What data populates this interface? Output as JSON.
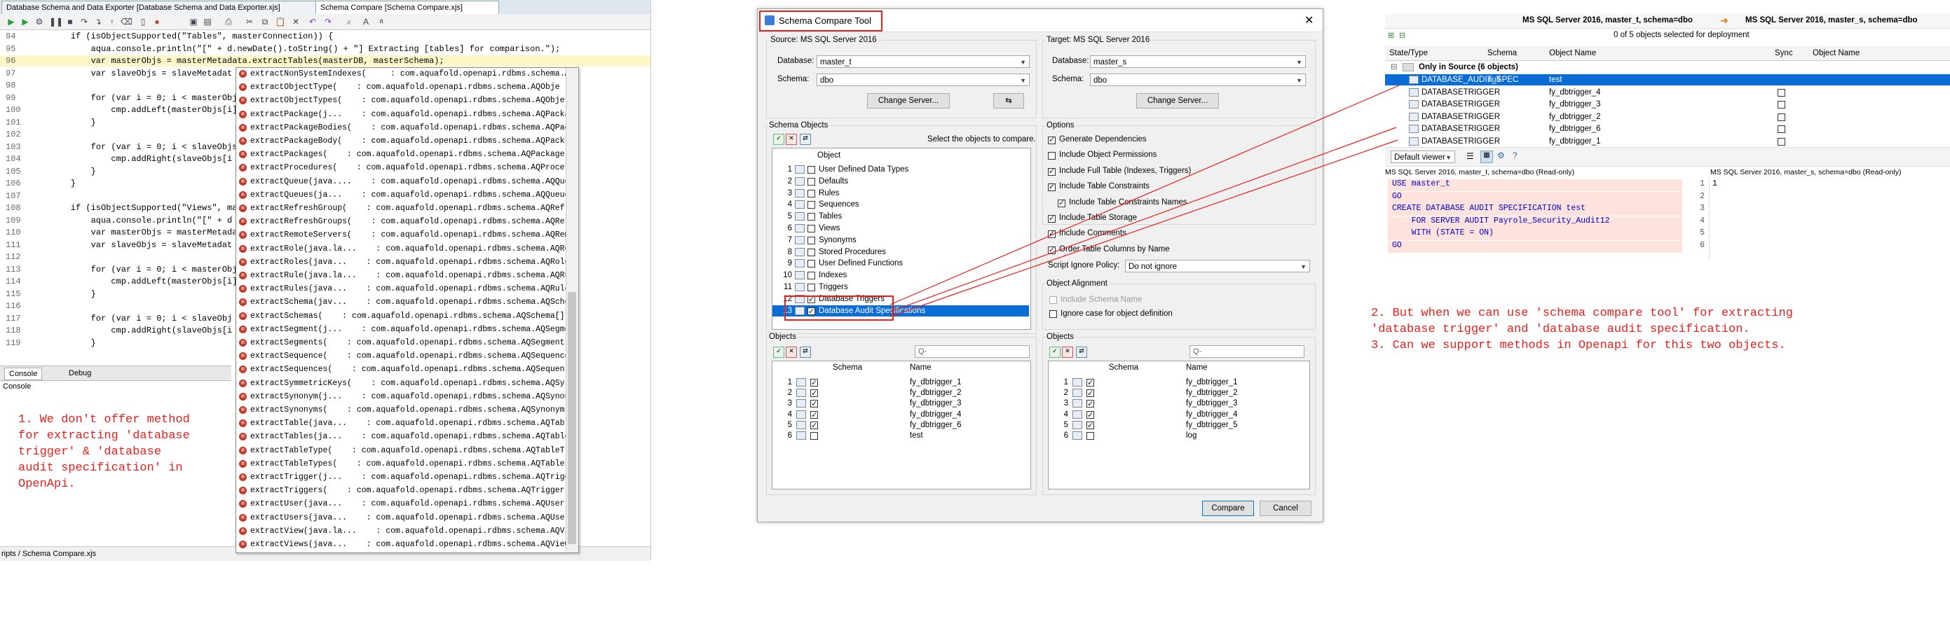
{
  "ide": {
    "tabs": [
      "Database Schema and Data Exporter [Database Schema and Data Exporter.xjs]",
      "Schema Compare [Schema Compare.xjs]"
    ],
    "code_lines": [
      {
        "n": "94",
        "t": "    if (isObjectSupported(\"Tables\", masterConnection)) {"
      },
      {
        "n": "95",
        "t": "        aqua.console.println(\"[\" + d.newDate().toString() + \"] Extracting [tables] for comparison.\");"
      },
      {
        "n": "96",
        "t": "        var masterObjs = masterMetadata.extractTables(masterDB, masterSchema);"
      },
      {
        "n": "97",
        "t": "        var slaveObjs = slaveMetadat"
      },
      {
        "n": "98",
        "t": ""
      },
      {
        "n": "99",
        "t": "        for (var i = 0; i < masterObj"
      },
      {
        "n": "100",
        "t": "            cmp.addLeft(masterObjs[i]"
      },
      {
        "n": "101",
        "t": "        }"
      },
      {
        "n": "102",
        "t": ""
      },
      {
        "n": "103",
        "t": "        for (var i = 0; i < slaveObjs"
      },
      {
        "n": "104",
        "t": "            cmp.addRight(slaveObjs[i"
      },
      {
        "n": "105",
        "t": "        }"
      },
      {
        "n": "106",
        "t": "    }"
      },
      {
        "n": "107",
        "t": ""
      },
      {
        "n": "108",
        "t": "    if (isObjectSupported(\"Views\", ma"
      },
      {
        "n": "109",
        "t": "        aqua.console.println(\"[\" + d"
      },
      {
        "n": "110",
        "t": "        var masterObjs = masterMetada"
      },
      {
        "n": "111",
        "t": "        var slaveObjs = slaveMetadat"
      },
      {
        "n": "112",
        "t": ""
      },
      {
        "n": "113",
        "t": "        for (var i = 0; i < masterObj"
      },
      {
        "n": "114",
        "t": "            cmp.addLeft(masterObjs[i]"
      },
      {
        "n": "115",
        "t": "        }"
      },
      {
        "n": "116",
        "t": ""
      },
      {
        "n": "117",
        "t": "        for (var i = 0; i < slaveObj"
      },
      {
        "n": "118",
        "t": "            cmp.addRight(slaveObjs[i"
      },
      {
        "n": "119",
        "t": "        }"
      }
    ],
    "autocomplete": [
      "extractNonSystemIndexes(     : com.aquafold.openapi.rdbms.schema.A",
      "extractObjectType(    : com.aquafold.openapi.rdbms.schema.AQObje",
      "extractObjectTypes(    : com.aquafold.openapi.rdbms.schema.AQObje",
      "extractPackage(j...    : com.aquafold.openapi.rdbms.schema.AQPackage",
      "extractPackageBodies(    : com.aquafold.openapi.rdbms.schema.AQPack",
      "extractPackageBody(    : com.aquafold.openapi.rdbms.schema.AQPack",
      "extractPackages(    : com.aquafold.openapi.rdbms.schema.AQPackage[]",
      "extractProcedures(    : com.aquafold.openapi.rdbms.schema.AQProce",
      "extractQueue(java....    : com.aquafold.openapi.rdbms.schema.AQQueue",
      "extractQueues(ja...    : com.aquafold.openapi.rdbms.schema.AQQueue[",
      "extractRefreshGroup(    : com.aquafold.openapi.rdbms.schema.AQRef",
      "extractRefreshGroups(    : com.aquafold.openapi.rdbms.schema.AQRe",
      "extractRemoteServers(    : com.aquafold.openapi.rdbms.schema.AQRem",
      "extractRole(java.la...    : com.aquafold.openapi.rdbms.schema.AQRole",
      "extractRoles(java...    : com.aquafold.openapi.rdbms.schema.AQRole[]",
      "extractRule(java.la...    : com.aquafold.openapi.rdbms.schema.AQRule",
      "extractRules(java...    : com.aquafold.openapi.rdbms.schema.AQRule[]",
      "extractSchema(jav...    : com.aquafold.openapi.rdbms.schema.AQSchema",
      "extractSchemas(    : com.aquafold.openapi.rdbms.schema.AQSchema[]",
      "extractSegment(j...    : com.aquafold.openapi.rdbms.schema.AQSegment",
      "extractSegments(    : com.aquafold.openapi.rdbms.schema.AQSegment[]",
      "extractSequence(    : com.aquafold.openapi.rdbms.schema.AQSequence",
      "extractSequences(    : com.aquafold.openapi.rdbms.schema.AQSequen",
      "extractSymmetricKeys(    : com.aquafold.openapi.rdbms.schema.AQSy",
      "extractSynonym(j...    : com.aquafold.openapi.rdbms.schema.AQSynonym",
      "extractSynonyms(    : com.aquafold.openapi.rdbms.schema.AQSynonym[]",
      "extractTable(java...    : com.aquafold.openapi.rdbms.schema.AQTable",
      "extractTables(ja...    : com.aquafold.openapi.rdbms.schema.AQTable[]",
      "extractTableType(    : com.aquafold.openapi.rdbms.schema.AQTableT",
      "extractTableTypes(    : com.aquafold.openapi.rdbms.schema.AQTable",
      "extractTrigger(j...    : com.aquafold.openapi.rdbms.schema.AQTrigger",
      "extractTriggers(    : com.aquafold.openapi.rdbms.schema.AQTrigger[]",
      "extractUser(java...    : com.aquafold.openapi.rdbms.schema.AQUser",
      "extractUsers(java...    : com.aquafold.openapi.rdbms.schema.AQUser[]",
      "extractView(java.la...    : com.aquafold.openapi.rdbms.schema.AQView",
      "extractViews(java...    : com.aquafold.openapi.rdbms.schema.AQView[]"
    ],
    "console_tab": "Console",
    "debug_tab": "Debug",
    "console_label": "Console",
    "status": "ripts / Schema Compare.xjs",
    "note1": "1. We don't offer method\nfor extracting 'database\ntrigger' & 'database\naudit specification' in\nOpenApi."
  },
  "dialog": {
    "title": "Schema Compare Tool",
    "source": {
      "label": "Source: MS SQL Server 2016",
      "db_label": "Database:",
      "db_value": "master_t",
      "schema_label": "Schema:",
      "schema_value": "dbo",
      "change_server": "Change Server..."
    },
    "target": {
      "label": "Target: MS SQL Server 2016",
      "db_label": "Database:",
      "db_value": "master_s",
      "schema_label": "Schema:",
      "schema_value": "dbo",
      "change_server": "Change Server..."
    },
    "schema_objects_label": "Schema Objects",
    "select_hint": "Select the objects to compare.",
    "object_col": "Object",
    "objects": [
      {
        "n": "1",
        "name": "User Defined Data Types",
        "checked": false
      },
      {
        "n": "2",
        "name": "Defaults",
        "checked": false
      },
      {
        "n": "3",
        "name": "Rules",
        "checked": false
      },
      {
        "n": "4",
        "name": "Sequences",
        "checked": false
      },
      {
        "n": "5",
        "name": "Tables",
        "checked": false
      },
      {
        "n": "6",
        "name": "Views",
        "checked": false
      },
      {
        "n": "7",
        "name": "Synonyms",
        "checked": false
      },
      {
        "n": "8",
        "name": "Stored Procedures",
        "checked": false
      },
      {
        "n": "9",
        "name": "User Defined Functions",
        "checked": false
      },
      {
        "n": "10",
        "name": "Indexes",
        "checked": false
      },
      {
        "n": "11",
        "name": "Triggers",
        "checked": false
      },
      {
        "n": "12",
        "name": "Database Triggers",
        "checked": true
      },
      {
        "n": "13",
        "name": "Database Audit Specifications",
        "checked": true
      }
    ],
    "options_label": "Options",
    "options": [
      {
        "label": "Generate Dependencies",
        "checked": true,
        "indent": false
      },
      {
        "label": "Include Object Permissions",
        "checked": false,
        "indent": false
      },
      {
        "label": "Include Full Table (Indexes, Triggers)",
        "checked": true,
        "indent": false
      },
      {
        "label": "Include Table Constraints",
        "checked": true,
        "indent": false
      },
      {
        "label": "Include Table Constraints Names",
        "checked": true,
        "indent": true
      },
      {
        "label": "Include Table Storage",
        "checked": true,
        "indent": false
      },
      {
        "label": "Include Comments",
        "checked": true,
        "indent": false
      },
      {
        "label": "Order Table Columns by Name",
        "checked": true,
        "indent": false
      }
    ],
    "script_ignore_label": "Script Ignore Policy:",
    "script_ignore_value": "Do not ignore",
    "alignment_label": "Object Alignment",
    "include_schema_name": "Include Schema Name",
    "ignore_case": "Ignore case for object definition",
    "objects_label": "Objects",
    "col_schema": "Schema",
    "col_name": "Name",
    "left_objects": [
      {
        "n": "1",
        "name": "fy_dbtrigger_1",
        "checked": true
      },
      {
        "n": "2",
        "name": "fy_dbtrigger_2",
        "checked": true
      },
      {
        "n": "3",
        "name": "fy_dbtrigger_3",
        "checked": true
      },
      {
        "n": "4",
        "name": "fy_dbtrigger_4",
        "checked": true
      },
      {
        "n": "5",
        "name": "fy_dbtrigger_6",
        "checked": true
      },
      {
        "n": "6",
        "name": "test",
        "checked": false
      }
    ],
    "right_objects": [
      {
        "n": "1",
        "name": "fy_dbtrigger_1",
        "checked": true
      },
      {
        "n": "2",
        "name": "fy_dbtrigger_2",
        "checked": true
      },
      {
        "n": "3",
        "name": "fy_dbtrigger_3",
        "checked": true
      },
      {
        "n": "4",
        "name": "fy_dbtrigger_4",
        "checked": true
      },
      {
        "n": "5",
        "name": "fy_dbtrigger_5",
        "checked": true
      },
      {
        "n": "6",
        "name": "log",
        "checked": false
      }
    ],
    "search_placeholder": "Q-",
    "compare": "Compare",
    "cancel": "Cancel"
  },
  "results": {
    "left_server": "MS SQL Server 2016, master_t, schema=dbo",
    "right_server": "MS SQL Server 2016, master_s,  schema=dbo",
    "selected_count": "0 of 5 objects selected for deployment",
    "col_state": "State/Type",
    "col_schema": "Schema",
    "col_name": "Object Name",
    "col_sync": "Sync",
    "col_name2": "Object Name",
    "group": "Only in Source (6 objects)",
    "rows": [
      {
        "type": "DATABASE_AUDIT_SPEC",
        "schema": "null",
        "name": "test",
        "selected": true
      },
      {
        "type": "DATABASETRIGGER",
        "schema": "",
        "name": "fy_dbtrigger_4",
        "selected": false
      },
      {
        "type": "DATABASETRIGGER",
        "schema": "",
        "name": "fy_dbtrigger_3",
        "selected": false
      },
      {
        "type": "DATABASETRIGGER",
        "schema": "",
        "name": "fy_dbtrigger_2",
        "selected": false
      },
      {
        "type": "DATABASETRIGGER",
        "schema": "",
        "name": "fy_dbtrigger_6",
        "selected": false
      },
      {
        "type": "DATABASETRIGGER",
        "schema": "",
        "name": "fy_dbtrigger_1",
        "selected": false
      }
    ],
    "viewer": "Default viewer",
    "left_pane_title": "MS SQL Server 2016, master_t, schema=dbo (Read-only)",
    "right_pane_title": "MS SQL Server 2016, master_s, schema=dbo (Read-only)",
    "sql_lines": [
      {
        "n": "1",
        "t": "USE master_t"
      },
      {
        "n": "2",
        "t": "GO"
      },
      {
        "n": "3",
        "t": "CREATE DATABASE AUDIT SPECIFICATION test"
      },
      {
        "n": "4",
        "t": "    FOR SERVER AUDIT Payrole_Security_Audit12"
      },
      {
        "n": "5",
        "t": "    WITH (STATE = ON)"
      },
      {
        "n": "6",
        "t": "GO"
      }
    ],
    "right_line": "1",
    "note2": "2. But when we can use 'schema compare tool' for extracting\n'database trigger' and 'database audit specification.\n3. Can we support methods in Openapi for this two objects."
  }
}
